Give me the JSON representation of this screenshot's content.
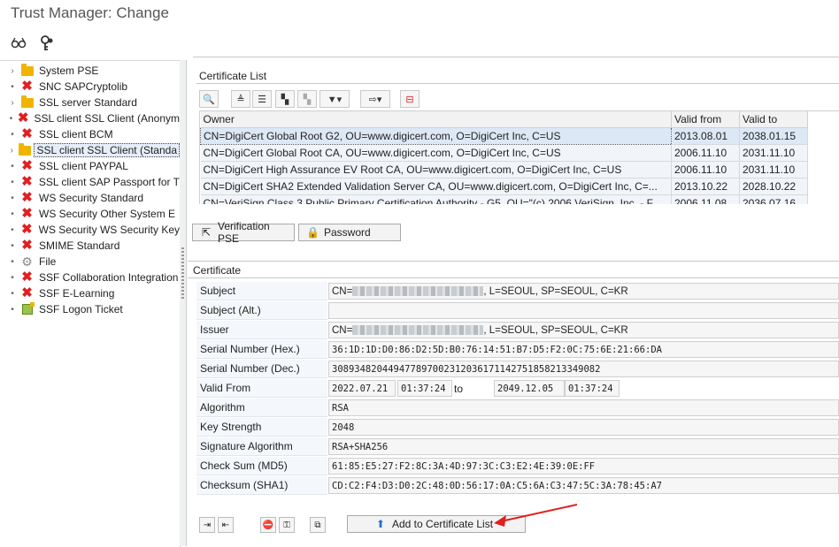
{
  "window": {
    "title": "Trust Manager: Change"
  },
  "toolbar": {
    "icons": [
      "glasses-icon",
      "key-icon"
    ]
  },
  "tree": {
    "items": [
      {
        "label": "System PSE",
        "icon": "folder",
        "expander": "›"
      },
      {
        "label": "SNC SAPCryptolib",
        "icon": "red-x",
        "expander": "•"
      },
      {
        "label": "SSL server Standard",
        "icon": "folder",
        "expander": "›"
      },
      {
        "label": "SSL client SSL Client (Anonym",
        "icon": "red-x",
        "expander": "•"
      },
      {
        "label": "SSL client BCM",
        "icon": "red-x",
        "expander": "•"
      },
      {
        "label": "SSL client SSL Client (Standa",
        "icon": "folder",
        "expander": "›",
        "selected": true
      },
      {
        "label": "SSL client PAYPAL",
        "icon": "red-x",
        "expander": "•"
      },
      {
        "label": "SSL client SAP Passport for T",
        "icon": "red-x",
        "expander": "•"
      },
      {
        "label": "WS Security Standard",
        "icon": "red-x",
        "expander": "•"
      },
      {
        "label": "WS Security Other System E",
        "icon": "red-x",
        "expander": "•"
      },
      {
        "label": "WS Security WS Security Key",
        "icon": "red-x",
        "expander": "•"
      },
      {
        "label": "SMIME Standard",
        "icon": "red-x",
        "expander": "•"
      },
      {
        "label": "File",
        "icon": "gear",
        "expander": "•"
      },
      {
        "label": "SSF Collaboration Integration",
        "icon": "red-x",
        "expander": "•"
      },
      {
        "label": "SSF E-Learning",
        "icon": "red-x",
        "expander": "•"
      },
      {
        "label": "SSF Logon Ticket",
        "icon": "ticket",
        "expander": "•"
      }
    ]
  },
  "cert_list": {
    "title": "Certificate List",
    "columns": [
      "Owner",
      "Valid from",
      "Valid to"
    ],
    "rows": [
      [
        "CN=DigiCert Global Root G2, OU=www.digicert.com, O=DigiCert Inc, C=US",
        "2013.08.01",
        "2038.01.15"
      ],
      [
        "CN=DigiCert Global Root CA, OU=www.digicert.com, O=DigiCert Inc, C=US",
        "2006.11.10",
        "2031.11.10"
      ],
      [
        "CN=DigiCert High Assurance EV Root CA, OU=www.digicert.com, O=DigiCert Inc, C=US",
        "2006.11.10",
        "2031.11.10"
      ],
      [
        "CN=DigiCert SHA2 Extended Validation Server CA, OU=www.digicert.com, O=DigiCert Inc, C=...",
        "2013.10.22",
        "2028.10.22"
      ],
      [
        "CN=VeriSign Class 3 Public Primary Certification Authority - G5, OU=\"(c) 2006 VeriSign, Inc. - F",
        "2006.11.08",
        "2036.07.16"
      ]
    ],
    "buttons": {
      "verification_pse": "Verification PSE",
      "password": "Password"
    }
  },
  "certificate": {
    "title": "Certificate",
    "subject_label": "Subject",
    "subject_prefix": "CN=",
    "subject_suffix": ", L=SEOUL, SP=SEOUL, C=KR",
    "subject_alt_label": "Subject (Alt.)",
    "subject_alt": "",
    "issuer_label": "Issuer",
    "issuer_prefix": "CN=",
    "issuer_suffix": ", L=SEOUL, SP=SEOUL, C=KR",
    "serial_hex_label": "Serial Number (Hex.)",
    "serial_hex": "36:1D:1D:D0:86:D2:5D:B0:76:14:51:B7:D5:F2:0C:75:6E:21:66:DA",
    "serial_dec_label": "Serial Number (Dec.)",
    "serial_dec": "308934820449477897002312036171142751858213349082",
    "valid_from_label": "Valid From",
    "valid_from_date": "2022.07.21",
    "valid_from_time": "01:37:24",
    "to_label": "to",
    "valid_to_date": "2049.12.05",
    "valid_to_time": "01:37:24",
    "algorithm_label": "Algorithm",
    "algorithm": "RSA",
    "key_strength_label": "Key Strength",
    "key_strength": "2048",
    "sig_alg_label": "Signature Algorithm",
    "sig_alg": "RSA+SHA256",
    "md5_label": "Check Sum (MD5)",
    "md5": "61:85:E5:27:F2:8C:3A:4D:97:3C:C3:E2:4E:39:0E:FF",
    "sha1_label": "Checksum (SHA1)",
    "sha1": "CD:C2:F4:D3:D0:2C:48:0D:56:17:0A:C5:6A:C3:47:5C:3A:78:45:A7"
  },
  "actions": {
    "add_to_list": "Add to Certificate List"
  },
  "colors": {
    "accent": "#e02020",
    "folder": "#f0b400",
    "selection": "#dce8f6"
  }
}
